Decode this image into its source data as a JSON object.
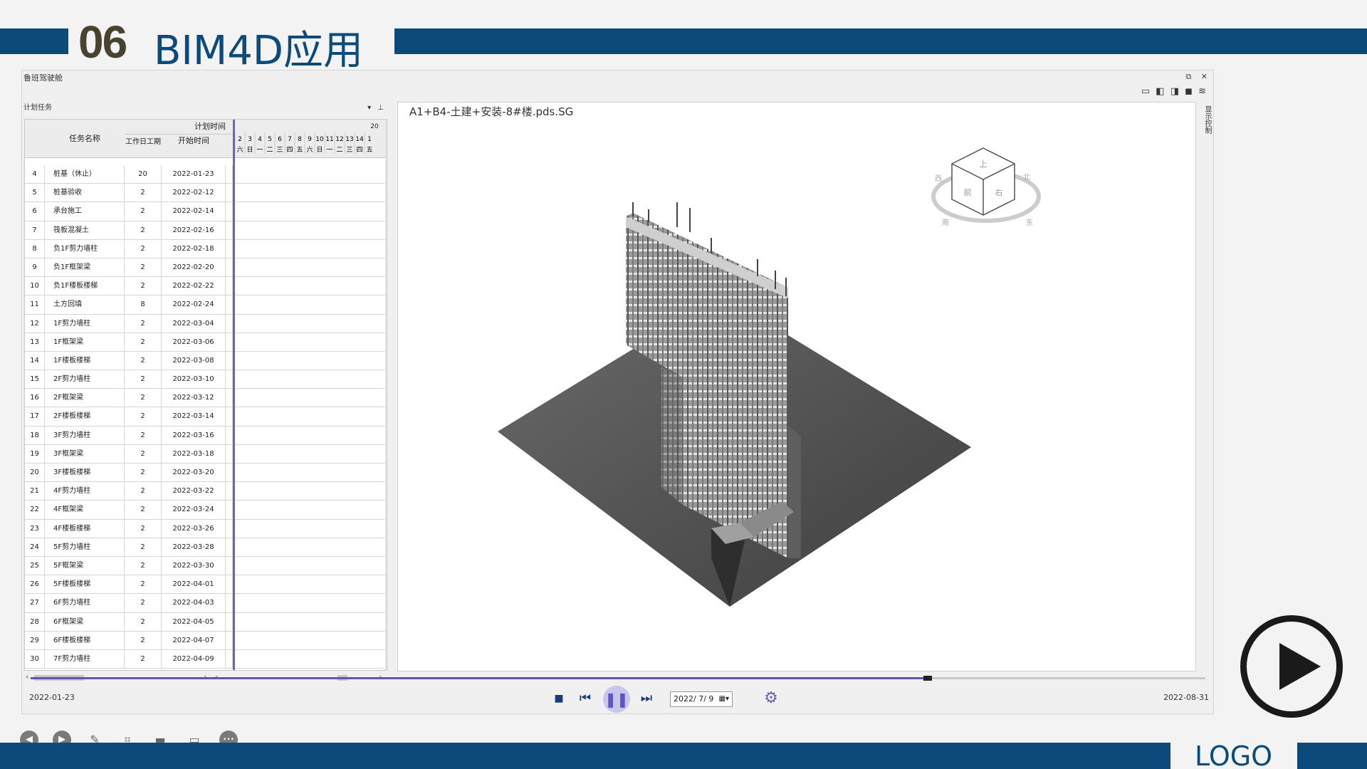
{
  "slide": {
    "number": "06",
    "title": "BIM4D应用",
    "logo": "LOGO"
  },
  "window": {
    "title": "鲁班驾驶舱",
    "restore_icon": "⧉",
    "close_icon": "✕",
    "task_panel_title": "计划任务",
    "task_panel_menu_icon": "▾",
    "task_panel_pin_icon": "📌",
    "viewport_label": "A1+B4-土建+安装-8#楼.pds.SG",
    "right_panel_label": "显示控制"
  },
  "table": {
    "group_header": "计划时间",
    "col_name": "任务名称",
    "col_duration": "工作日工期",
    "col_start": "开始时间",
    "gantt_year_prefix": "20",
    "gantt_days": [
      "2",
      "3",
      "4",
      "5",
      "6",
      "7",
      "8",
      "9",
      "10",
      "11",
      "12",
      "13",
      "14",
      "1"
    ],
    "gantt_weekdays": [
      "六",
      "日",
      "一",
      "二",
      "三",
      "四",
      "五",
      "六",
      "日",
      "一",
      "二",
      "三",
      "四",
      "五"
    ],
    "rows": [
      {
        "id": "4",
        "name": "桩基（休止）",
        "dur": "20",
        "start": "2022-01-23"
      },
      {
        "id": "5",
        "name": "桩基验收",
        "dur": "2",
        "start": "2022-02-12"
      },
      {
        "id": "6",
        "name": "承台施工",
        "dur": "2",
        "start": "2022-02-14"
      },
      {
        "id": "7",
        "name": "筏板混凝土",
        "dur": "2",
        "start": "2022-02-16"
      },
      {
        "id": "8",
        "name": "负1F剪力墙柱",
        "dur": "2",
        "start": "2022-02-18"
      },
      {
        "id": "9",
        "name": "负1F框架梁",
        "dur": "2",
        "start": "2022-02-20"
      },
      {
        "id": "10",
        "name": "负1F楼板楼梯",
        "dur": "2",
        "start": "2022-02-22"
      },
      {
        "id": "11",
        "name": "土方回填",
        "dur": "8",
        "start": "2022-02-24"
      },
      {
        "id": "12",
        "name": "1F剪力墙柱",
        "dur": "2",
        "start": "2022-03-04"
      },
      {
        "id": "13",
        "name": "1F框架梁",
        "dur": "2",
        "start": "2022-03-06"
      },
      {
        "id": "14",
        "name": "1F楼板楼梯",
        "dur": "2",
        "start": "2022-03-08"
      },
      {
        "id": "15",
        "name": "2F剪力墙柱",
        "dur": "2",
        "start": "2022-03-10"
      },
      {
        "id": "16",
        "name": "2F框架梁",
        "dur": "2",
        "start": "2022-03-12"
      },
      {
        "id": "17",
        "name": "2F楼板楼梯",
        "dur": "2",
        "start": "2022-03-14"
      },
      {
        "id": "18",
        "name": "3F剪力墙柱",
        "dur": "2",
        "start": "2022-03-16"
      },
      {
        "id": "19",
        "name": "3F框架梁",
        "dur": "2",
        "start": "2022-03-18"
      },
      {
        "id": "20",
        "name": "3F楼板楼梯",
        "dur": "2",
        "start": "2022-03-20"
      },
      {
        "id": "21",
        "name": "4F剪力墙柱",
        "dur": "2",
        "start": "2022-03-22"
      },
      {
        "id": "22",
        "name": "4F框架梁",
        "dur": "2",
        "start": "2022-03-24"
      },
      {
        "id": "23",
        "name": "4F楼板楼梯",
        "dur": "2",
        "start": "2022-03-26"
      },
      {
        "id": "24",
        "name": "5F剪力墙柱",
        "dur": "2",
        "start": "2022-03-28"
      },
      {
        "id": "25",
        "name": "5F框架梁",
        "dur": "2",
        "start": "2022-03-30"
      },
      {
        "id": "26",
        "name": "5F楼板楼梯",
        "dur": "2",
        "start": "2022-04-01"
      },
      {
        "id": "27",
        "name": "6F剪力墙柱",
        "dur": "2",
        "start": "2022-04-03"
      },
      {
        "id": "28",
        "name": "6F框架梁",
        "dur": "2",
        "start": "2022-04-05"
      },
      {
        "id": "29",
        "name": "6F楼板楼梯",
        "dur": "2",
        "start": "2022-04-07"
      },
      {
        "id": "30",
        "name": "7F剪力墙柱",
        "dur": "2",
        "start": "2022-04-09"
      }
    ]
  },
  "viewcube": {
    "top": "上",
    "front": "前",
    "right": "右",
    "n": "北",
    "s": "南",
    "e": "东",
    "w": "西"
  },
  "playback": {
    "start_date": "2022-01-23",
    "end_date": "2022-08-31",
    "current_date": "2022/ 7/ 9",
    "progress": 0.76,
    "stop_icon": "■",
    "prev_icon": "⏮",
    "pause_icon": "❚❚",
    "next_icon": "⏭",
    "calendar_icon": "▦▾",
    "settings_icon": "⚙"
  },
  "bottom_toolbar": {
    "back_icon": "◀",
    "forward_icon": "▶",
    "pen_icon": "✎",
    "capture_icon": "⌗",
    "camera_icon": "▬",
    "comment_icon": "▭",
    "more_icon": "•••"
  },
  "colors": {
    "brand": "#0b4a7a",
    "accent": "#6a4fb4",
    "number": "#4a4230"
  }
}
